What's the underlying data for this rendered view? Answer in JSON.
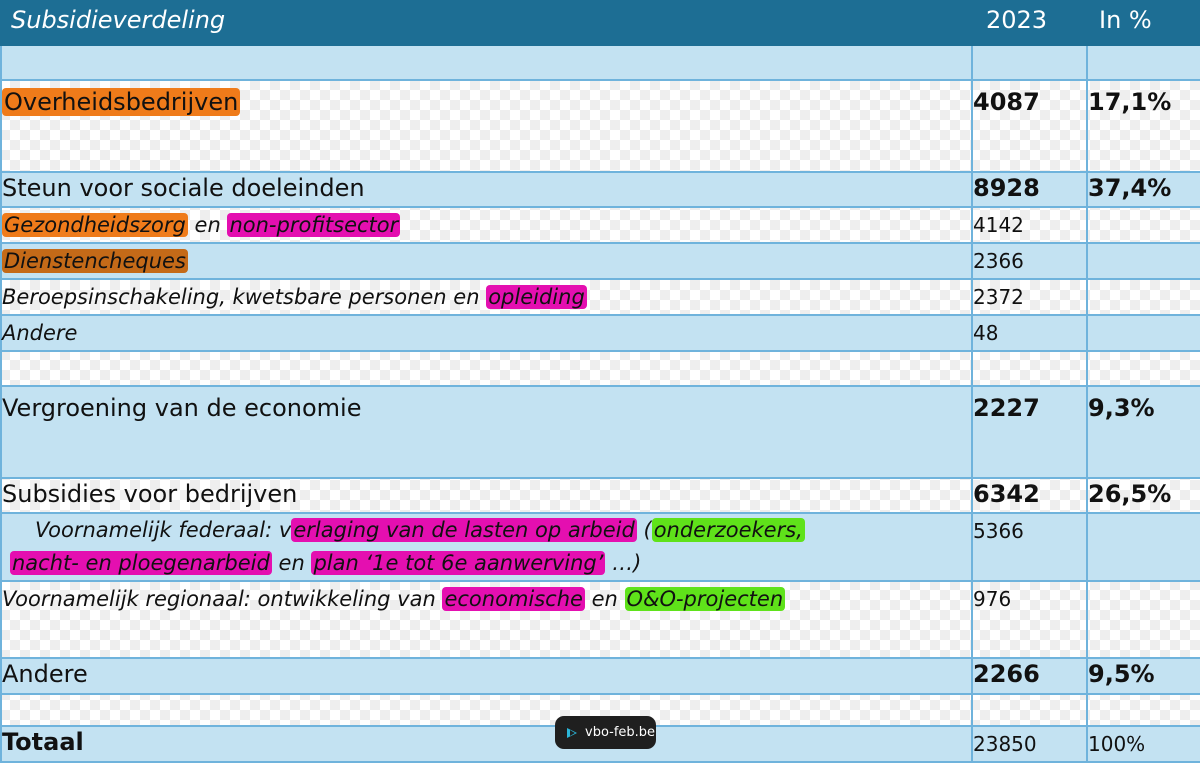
{
  "header": {
    "title": "Subsidieverdeling",
    "year": "2023",
    "percent": "In %"
  },
  "sections": {
    "overheid": {
      "label": "Overheidsbedrijven",
      "value": "4087",
      "percent": "17,1%"
    },
    "sociaal": {
      "label": "Steun voor sociale doeleinden",
      "value": "8928",
      "percent": "37,4%",
      "items": [
        {
          "part1": "Gezondheidszorg",
          "part2": " en ",
          "part3": "non-profitsector",
          "value": "4142"
        },
        {
          "label": "Dienstencheques",
          "value": "2366"
        },
        {
          "part1": "Beroepsinschakeling, kwetsbare personen en ",
          "part2": "opleiding",
          "value": "2372"
        },
        {
          "label": "Andere",
          "value": "48"
        }
      ]
    },
    "vergroening": {
      "label": "Vergroening van de economie",
      "value": "2227",
      "percent": "9,3%"
    },
    "bedrijven": {
      "label": "Subsidies voor bedrijven",
      "value": "6342",
      "percent": "26,5%",
      "federaal": {
        "p1": "Voornamelijk federaal: v",
        "p2": "erlaging van de lasten op arbeid",
        "p3": " (",
        "p4": "onderzoekers,",
        "p5": "nacht- en ploegenarbeid",
        "p6": " en ",
        "p7": "plan ‘1e tot 6e aanwerving’",
        "p8": " …)",
        "value": "5366"
      },
      "regionaal": {
        "p1": "Voornamelijk regionaal: ontwikkeling van ",
        "p2": "economische",
        "p3": " en ",
        "p4": "O&O-projecten",
        "value": "976"
      }
    },
    "andere": {
      "label": "Andere",
      "value": "2266",
      "percent": "9,5%"
    },
    "totaal": {
      "label": "Totaal",
      "value": "23850",
      "percent": "100%"
    }
  },
  "watermark": {
    "text": "vbo-feb.be"
  },
  "colors": {
    "header": "#1d6e94",
    "row_blue": "#c3e2f2",
    "border": "#6fb3dc",
    "highlight_orange": "#ef7b1a",
    "highlight_brown": "#c46a18",
    "highlight_pink": "#e40fb0",
    "highlight_green": "#5fe21a"
  }
}
